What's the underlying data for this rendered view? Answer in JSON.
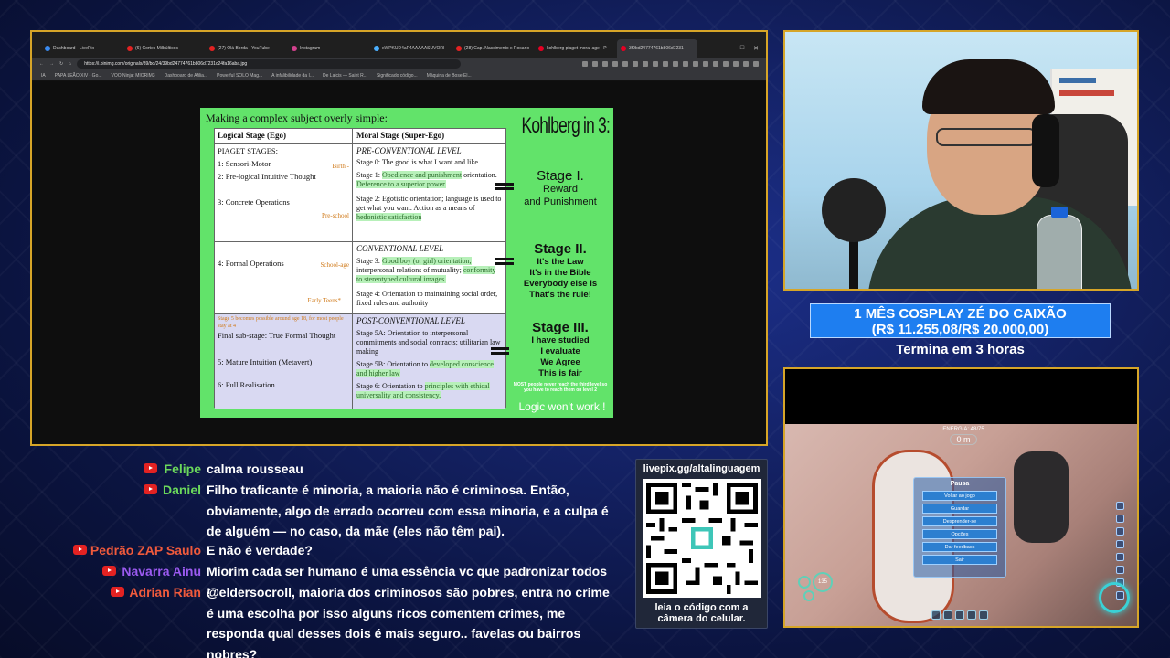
{
  "browser": {
    "tabs": [
      {
        "label": "Dashboard - LivePix",
        "color": "#3a8bf0"
      },
      {
        "label": "(6) Cortes Milbúlticos",
        "color": "#e32222"
      },
      {
        "label": "(27) Olá Borda - YouTube",
        "color": "#e32222"
      },
      {
        "label": "Instagram",
        "color": "#d2418d"
      },
      {
        "label": "xWPKUD4aF4AAAAASUVORI",
        "color": "#4bb0ff"
      },
      {
        "label": "(28) Cap. Nascimento x Rosario",
        "color": "#e32222"
      },
      {
        "label": "kohlberg piaget moral age - P",
        "color": "#e60023"
      },
      {
        "label": "3f9bd24774761b806d7231",
        "color": "#e60023"
      }
    ],
    "url": "https://i.pinimg.com/originals/39/bd/24/39bd24774761b806d7231c24fa16aba.jpg",
    "bookmarks": [
      "IA",
      "PAPA LEÃO XIV - Go...",
      "VOO.Ninja: MIORIM3",
      "Dashboard de Afilia...",
      "Powerful SOLO Mag...",
      "A infalibilidade da I...",
      "De Laicis — Saint R...",
      "Significado código...",
      "Máquina de Bose El..."
    ]
  },
  "slide": {
    "title": "Making a complex subject overly simple:",
    "kohlberg": "Kohlberg in 3:",
    "col_left_header": "Logical Stage (Ego)",
    "col_right_header": "Moral Stage (Super-Ego)",
    "piaget_label": "PIAGET STAGES:",
    "left": {
      "sensori": "1: Sensori-Motor",
      "prelogical": "2: Pre-logical Intuitive Thought",
      "concrete": "3: Concrete Operations",
      "formal": "4: Formal Operations",
      "final": "Final sub-stage: True Formal Thought",
      "mature": "5: Mature Intuition (Metavert)",
      "full": "6: Full Realisation",
      "purple_note": "Stage 5 becomes possible around age 18, for most people stay at 4"
    },
    "ages": {
      "birth": "Birth -",
      "preschool": "Pre-school",
      "schoolage": "School-age",
      "earlyteens": "Early Teens*"
    },
    "right": {
      "pre_level": "PRE-CONVENTIONAL LEVEL",
      "stage0": "Stage 0: The good is what I want and like",
      "stage1_a": "Stage 1:",
      "stage1_b": "Obedience and punishment",
      "stage1_c": "orientation.",
      "stage1_d": "Deference to a superior power.",
      "stage2_a": "Stage 2: Egotistic orientation; language is used to get what you want. Action as a means of",
      "stage2_b": "hedonistic satisfaction",
      "conv_level": "CONVENTIONAL LEVEL",
      "stage3_a": "Stage 3:",
      "stage3_b": "Good boy (or girl) orientation,",
      "stage3_c": "interpersonal relations of mutuality;",
      "stage3_d": "conformity to stereotyped cultural images.",
      "stage4": "Stage 4: Orientation to maintaining social order, fixed rules and authority",
      "post_level": "POST-CONVENTIONAL LEVEL",
      "stage5a": "Stage 5A: Orientation to interpersonal commitments and social contracts; utilitarian law making",
      "stage5b_a": "Stage 5B: Orientation to",
      "stage5b_b": "developed conscience and higher law",
      "stage6_a": "Stage 6: Orientation to",
      "stage6_b": "principles with ethical universality and consistency."
    },
    "stage1": {
      "title": "Stage I.",
      "body1": "Reward",
      "body2": "and Punishment"
    },
    "stage2": {
      "title": "Stage II.",
      "l1": "It's the Law",
      "l2": "It's in the Bible",
      "l3": "Everybody else is",
      "l4": "That's the rule!"
    },
    "stage3": {
      "title": "Stage III.",
      "l1": "I have studied",
      "l2": "I evaluate",
      "l3": "We Agree",
      "l4": "This is fair"
    },
    "footnote": "MOST people never reach the third level so you have to reach them on level 2",
    "logic": "Logic won't work !"
  },
  "goal": {
    "line1": "1 MÊS COSPLAY ZÉ DO CAIXÃO",
    "line2": "(R$ 11.255,08/R$ 20.000,00)",
    "progress": 0.5628,
    "sub": "Termina em 3 horas"
  },
  "game": {
    "energy": "ENERGIA: 48/75",
    "depth": "0 m",
    "pause_title": "Pausa",
    "pause_items": [
      "Voltar ao jogo",
      "Guardar",
      "Desprender-se",
      "Opções",
      "Dar feedback",
      "Sair"
    ],
    "hud_value": "135"
  },
  "chat": [
    {
      "name": "Felipe",
      "color": "n-green",
      "text": "calma rousseau"
    },
    {
      "name": "Daniel",
      "color": "n-green",
      "text": "Filho traficante é minoria, a maioria não é criminosa. Então, obviamente, algo de errado ocorreu com essa minoria, e a culpa é de alguém — no caso, da mãe (eles não têm pai)."
    },
    {
      "name": "Pedrão ZAP Saulo",
      "color": "n-red",
      "text": "E não é verdade?"
    },
    {
      "name": "Navarra Ainu",
      "color": "n-purple",
      "text": "Miorim cada ser humano é uma essência vc que padronizar todos !"
    },
    {
      "name": "Adrian Rian",
      "color": "n-red",
      "text": "@eldersocroll, maioria dos criminosos são pobres, entra no crime é uma escolha por isso alguns ricos comentem crimes, me responda qual desses dois é mais seguro.. favelas ou bairros nobres?"
    }
  ],
  "qr": {
    "header": "livepix.gg/altalinguagem",
    "footer1": "leia o código com a",
    "footer2": "câmera do celular."
  }
}
